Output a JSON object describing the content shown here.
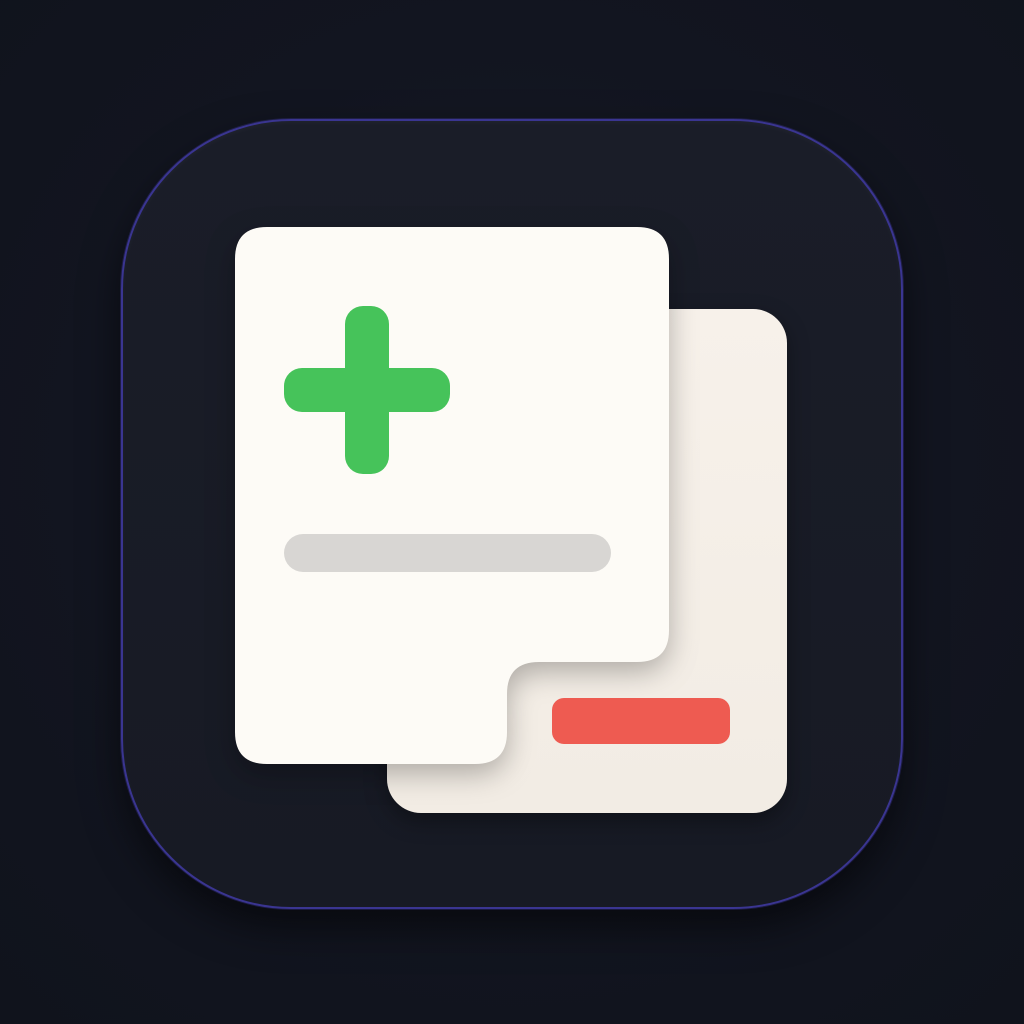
{
  "colors": {
    "background": "#121520",
    "icon_fill": "#1a1d28",
    "icon_border": "#3a3591",
    "sheet_front": "#fdfbf6",
    "sheet_back": "#f4eee7",
    "plus_green": "#46c35a",
    "line_gray": "#d8d6d3",
    "minus_red": "#ee5b51"
  },
  "icons": {
    "app_icon": "document-add-remove-icon",
    "plus": "plus-icon",
    "minus": "minus-icon",
    "front_document": "document-icon",
    "back_document": "document-icon"
  }
}
